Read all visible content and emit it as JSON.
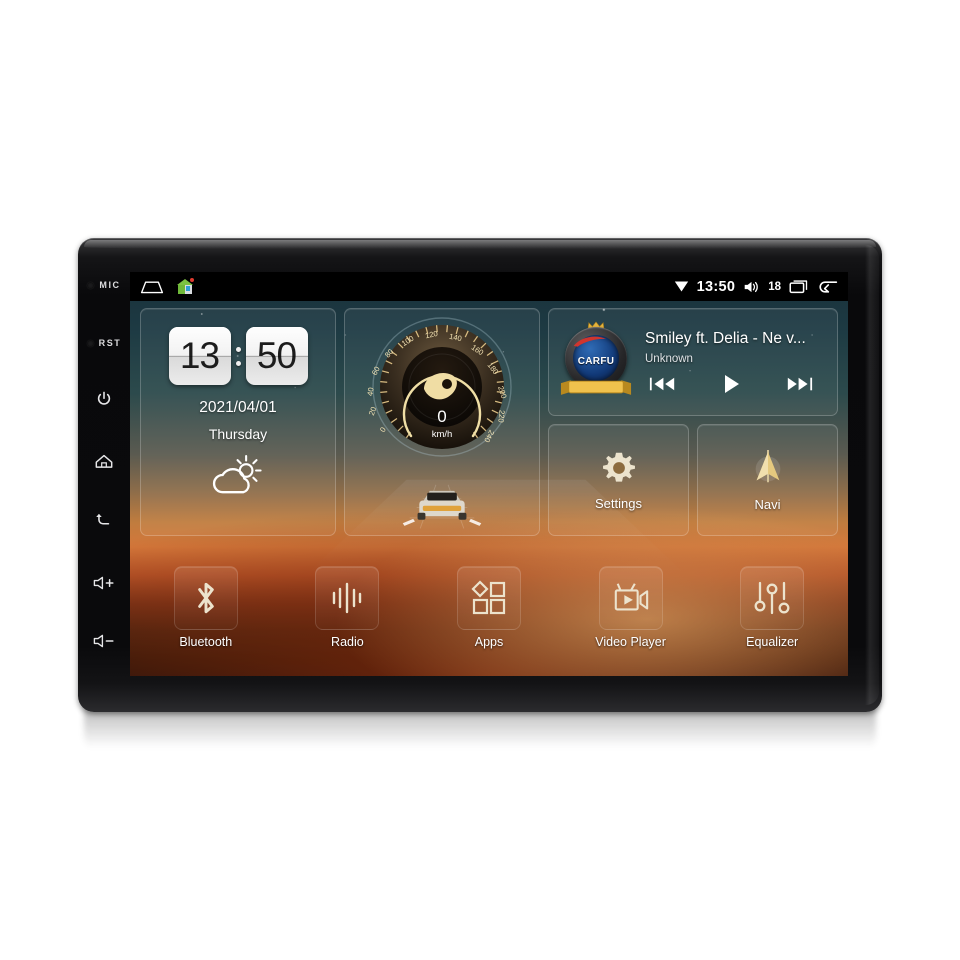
{
  "device": {
    "bezel_keys": [
      {
        "name": "mic",
        "label": "MIC",
        "type": "pinhole"
      },
      {
        "name": "reset",
        "label": "RST",
        "type": "pinhole"
      },
      {
        "name": "power",
        "label": "",
        "type": "power-icon"
      },
      {
        "name": "home",
        "label": "",
        "type": "home-icon"
      },
      {
        "name": "back",
        "label": "",
        "type": "back-icon"
      },
      {
        "name": "volume-up",
        "label": "+",
        "type": "volume-up-icon"
      },
      {
        "name": "volume-down",
        "label": "-",
        "type": "volume-down-icon"
      }
    ]
  },
  "statusbar": {
    "home_icon": "home-outline-icon",
    "app_icon": "house-app-icon",
    "wifi_icon": "wifi-icon",
    "time": "13:50",
    "volume_icon": "volume-icon",
    "volume_level": "18",
    "recents_icon": "recent-apps-icon",
    "back_icon": "back-arrow-icon"
  },
  "clock_widget": {
    "hours": "13",
    "minutes": "50",
    "date": "2021/04/01",
    "weekday": "Thursday",
    "weather_icon": "partly-cloudy-icon"
  },
  "speedometer_widget": {
    "value": "0",
    "unit": "km/h",
    "ticks": [
      "0",
      "20",
      "40",
      "60",
      "80",
      "100",
      "120",
      "140",
      "160",
      "180",
      "200",
      "220",
      "240"
    ],
    "min": 0,
    "max": 240,
    "car_icon": "car-rear-icon"
  },
  "media_widget": {
    "logo_text": "CARFU",
    "logo_icon": "carfu-badge-icon",
    "title": "Smiley ft. Delia - Ne v...",
    "artist": "Unknown",
    "prev_icon": "previous-track-icon",
    "play_icon": "play-icon",
    "next_icon": "next-track-icon"
  },
  "tiles": [
    {
      "label": "Settings",
      "icon": "gear-icon"
    },
    {
      "label": "Navi",
      "icon": "navigation-arrow-icon"
    }
  ],
  "dock": [
    {
      "label": "Bluetooth",
      "icon": "bluetooth-icon"
    },
    {
      "label": "Radio",
      "icon": "radio-waveform-icon"
    },
    {
      "label": "Apps",
      "icon": "apps-grid-icon"
    },
    {
      "label": "Video Player",
      "icon": "video-camera-icon"
    },
    {
      "label": "Equalizer",
      "icon": "equalizer-sliders-icon"
    }
  ],
  "colors": {
    "accent_gold": "#e8d9a8",
    "status_bar": "#000000",
    "text_primary": "#ffffff",
    "sky_top": "#19303a",
    "sunset": "#d4773a",
    "ground": "#20100a"
  }
}
